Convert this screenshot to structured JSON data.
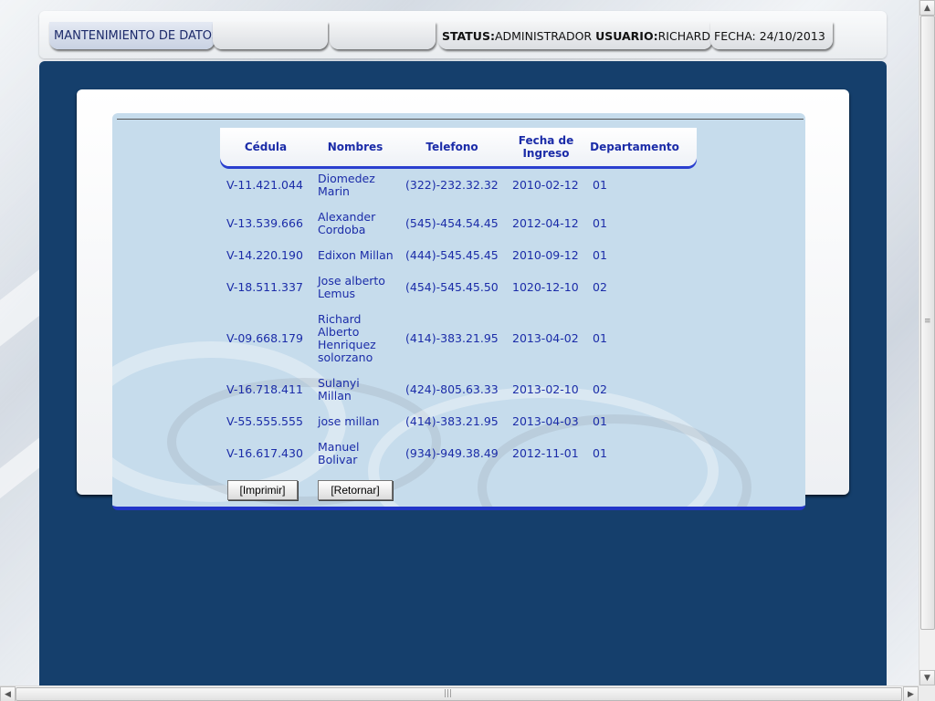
{
  "header": {
    "tab_mantenimiento": "MANTENIMIENTO DE DATOS",
    "tab_empty_1": "",
    "tab_empty_2": "",
    "status_label": "STATUS:",
    "status_value": "ADMINISTRADOR",
    "usuario_label": "USUARIO:",
    "usuario_value": "RICHARD",
    "fecha": "FECHA: 24/10/2013"
  },
  "table": {
    "columns": [
      "Cédula",
      "Nombres",
      "Telefono",
      "Fecha de Ingreso",
      "Departamento"
    ],
    "rows": [
      {
        "cedula": "V-11.421.044",
        "nombres": [
          "Diomedez",
          "Marin"
        ],
        "telefono": "(322)-232.32.32",
        "fecha": "2010-02-12",
        "departamento": "01"
      },
      {
        "cedula": "V-13.539.666",
        "nombres": [
          "Alexander",
          "Cordoba"
        ],
        "telefono": "(545)-454.54.45",
        "fecha": "2012-04-12",
        "departamento": "01"
      },
      {
        "cedula": "V-14.220.190",
        "nombres": [
          "Edixon Millan"
        ],
        "telefono": "(444)-545.45.45",
        "fecha": "2010-09-12",
        "departamento": "01"
      },
      {
        "cedula": "V-18.511.337",
        "nombres": [
          "Jose alberto",
          "Lemus"
        ],
        "telefono": "(454)-545.45.50",
        "fecha": "1020-12-10",
        "departamento": "02"
      },
      {
        "cedula": "V-09.668.179",
        "nombres": [
          "Richard",
          "Alberto",
          "Henriquez",
          "solorzano"
        ],
        "telefono": "(414)-383.21.95",
        "fecha": "2013-04-02",
        "departamento": "01"
      },
      {
        "cedula": "V-16.718.411",
        "nombres": [
          "Sulanyi",
          "Millan"
        ],
        "telefono": "(424)-805.63.33",
        "fecha": "2013-02-10",
        "departamento": "02"
      },
      {
        "cedula": "V-55.555.555",
        "nombres": [
          "jose millan"
        ],
        "telefono": "(414)-383.21.95",
        "fecha": "2013-04-03",
        "departamento": "01"
      },
      {
        "cedula": "V-16.617.430",
        "nombres": [
          "Manuel",
          "Bolivar"
        ],
        "telefono": "(934)-949.38.49",
        "fecha": "2012-11-01",
        "departamento": "01"
      }
    ]
  },
  "buttons": {
    "imprimir": "[Imprimir]",
    "retornar": "[Retornar]"
  },
  "scrollbars": {
    "up": "▲",
    "down": "▼",
    "left": "◀",
    "right": "▶",
    "grip_v": "≡",
    "grip_h": "|||"
  },
  "colors": {
    "panel_dark": "#153f6c",
    "content_bg": "#c6dcec",
    "text_blue": "#1b2ca8",
    "accent_blue": "#2a3fcf"
  }
}
